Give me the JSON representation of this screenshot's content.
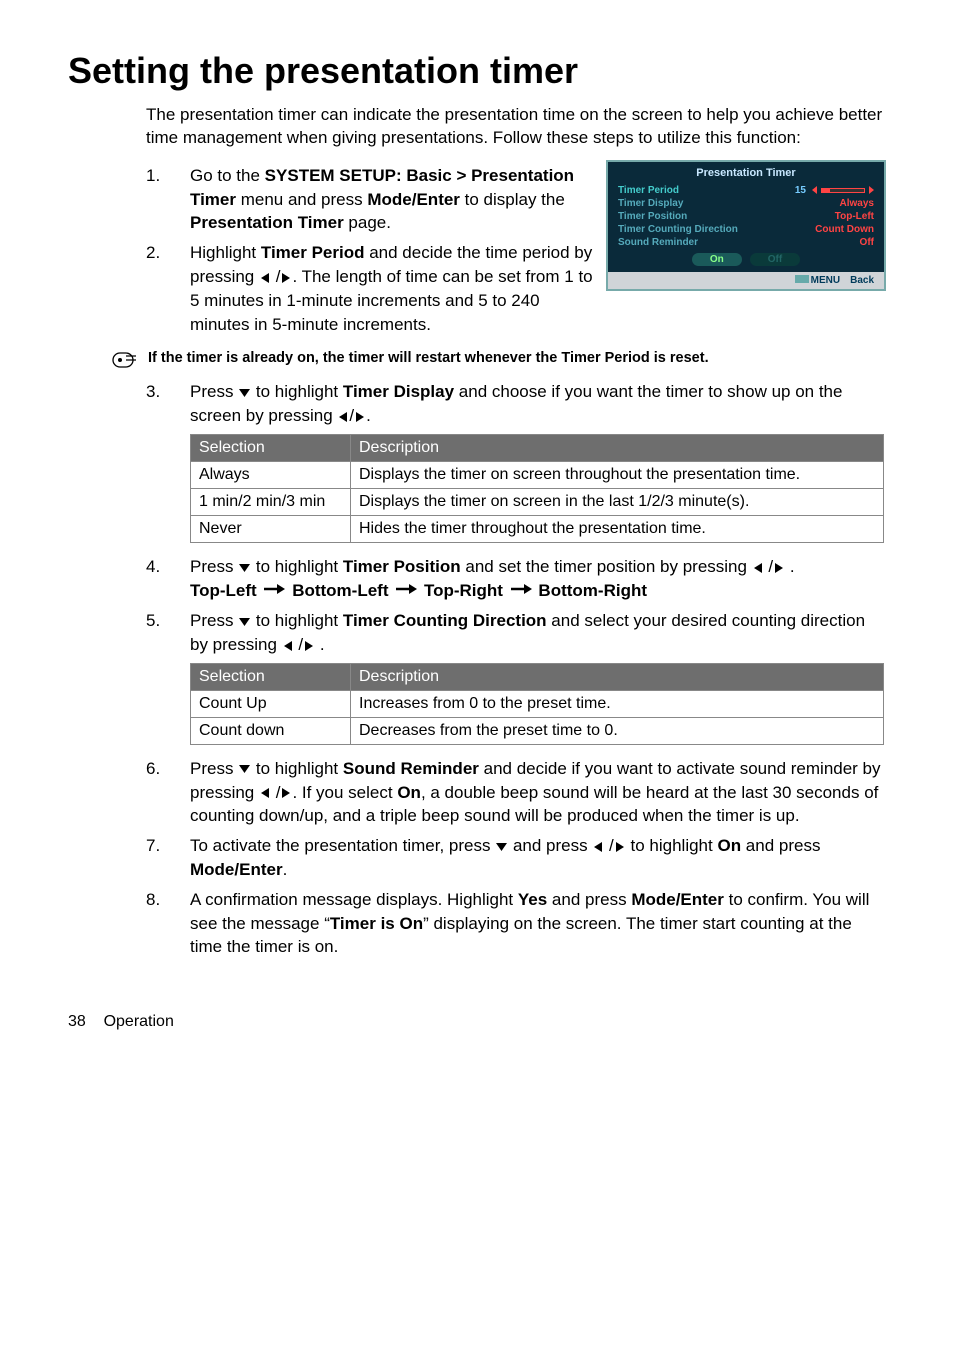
{
  "heading": "Setting the presentation timer",
  "intro": "The presentation timer can indicate the presentation time on the screen to help you achieve better time management when giving presentations. Follow these steps to utilize this function:",
  "step1": {
    "num": "1.",
    "pre": "Go to the ",
    "b1": "SYSTEM SETUP: Basic > Presentation Timer",
    "mid1": " menu and press ",
    "b2": "Mode/Enter",
    "mid2": " to display the ",
    "b3": "Presentation Timer",
    "post": " page."
  },
  "step2": {
    "num": "2.",
    "pre": "Highlight ",
    "b1": "Timer Period",
    "mid1": " and decide the time period by pressing ",
    "post": ". The length of time can be set from 1 to 5 minutes in 1-minute increments and 5 to 240 minutes in 5-minute increments."
  },
  "note": "If the timer is already on, the timer will restart whenever the Timer Period is reset.",
  "step3": {
    "num": "3.",
    "pre": "Press ",
    "mid1": " to highlight ",
    "b1": "Timer Display",
    "mid2": " and choose if you want the timer to show up on the screen by pressing ",
    "post": "."
  },
  "table1": {
    "h1": "Selection",
    "h2": "Description",
    "rows": [
      {
        "c1": "Always",
        "c2": "Displays the timer on screen throughout the presentation time."
      },
      {
        "c1": "1 min/2 min/3 min",
        "c2": "Displays the timer on screen in the last 1/2/3 minute(s)."
      },
      {
        "c1": "Never",
        "c2": "Hides the timer throughout the presentation time."
      }
    ]
  },
  "step4": {
    "num": "4.",
    "pre": "Press ",
    "mid1": " to highlight ",
    "b1": "Timer Position",
    "mid2": " and set the timer position by pressing ",
    "post": ".",
    "seq": {
      "a": "Top-Left",
      "b": "Bottom-Left",
      "c": "Top-Right",
      "d": "Bottom-Right"
    }
  },
  "step5": {
    "num": "5.",
    "pre": "Press ",
    "mid1": " to highlight ",
    "b1": "Timer Counting Direction",
    "mid2": " and select your desired counting direction by pressing ",
    "post": "."
  },
  "table2": {
    "h1": "Selection",
    "h2": "Description",
    "rows": [
      {
        "c1": "Count Up",
        "c2": "Increases from 0 to the preset time."
      },
      {
        "c1": "Count down",
        "c2": "Decreases from the preset time to 0."
      }
    ]
  },
  "step6": {
    "num": "6.",
    "pre": "Press ",
    "mid1": " to highlight ",
    "b1": "Sound Reminder",
    "mid2": " and decide if you want to activate sound reminder by pressing ",
    "mid3": ". If you select ",
    "b2": "On",
    "post": ", a double beep sound will be heard at the last 30 seconds of counting down/up, and a triple beep sound will be produced when the timer is up."
  },
  "step7": {
    "num": "7.",
    "pre": "To activate the presentation timer, press ",
    "mid1": " and press ",
    "mid2": " to highlight ",
    "b1": "On",
    "mid3": " and press ",
    "b2": "Mode/Enter",
    "post": "."
  },
  "step8": {
    "num": "8.",
    "pre": "A confirmation message displays. Highlight ",
    "b1": "Yes",
    "mid1": " and press ",
    "b2": "Mode/Enter",
    "mid2": " to confirm. You will see the message “",
    "b3": "Timer is On",
    "post": "” displaying on the screen. The timer start counting at the time the timer is on."
  },
  "osd": {
    "title": "Presentation Timer",
    "rows": [
      {
        "label": "Timer Period",
        "val": "15"
      },
      {
        "label": "Timer Display",
        "val": "Always"
      },
      {
        "label": "Timer Position",
        "val": "Top-Left"
      },
      {
        "label": "Timer Counting Direction",
        "val": "Count Down"
      },
      {
        "label": "Sound Reminder",
        "val": "Off"
      }
    ],
    "on": "On",
    "off": "Off",
    "menu": "MENU",
    "back": "Back"
  },
  "footer": {
    "page": "38",
    "section": "Operation"
  }
}
